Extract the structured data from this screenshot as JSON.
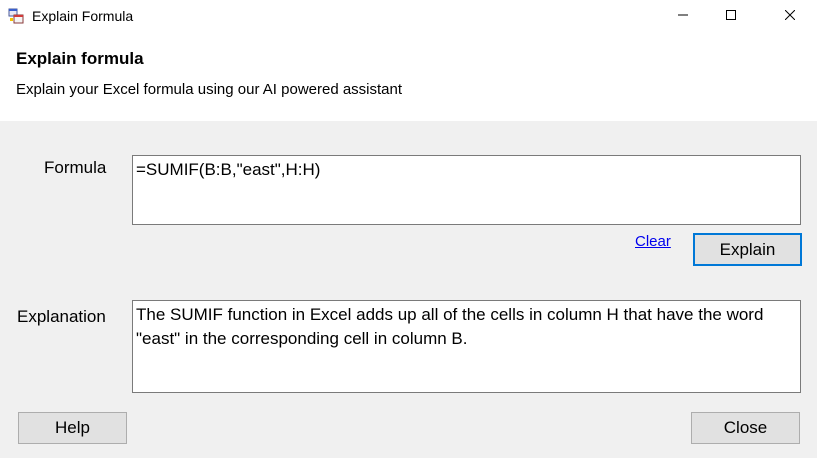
{
  "window": {
    "title": "Explain Formula",
    "icon": "form-app-icon",
    "controls": [
      "minimize-icon",
      "maximize-icon",
      "close-icon"
    ]
  },
  "header": {
    "title": "Explain formula",
    "subtitle": "Explain your Excel formula using our AI powered assistant"
  },
  "formula": {
    "label": "Formula",
    "value": "=SUMIF(B:B,\"east\",H:H)"
  },
  "actions": {
    "clear_label": "Clear",
    "explain_label": "Explain"
  },
  "explanation": {
    "label": "Explanation",
    "value": "The SUMIF function in Excel adds up all of the cells in column H that have the word \"east\" in the corresponding cell in column B."
  },
  "footer": {
    "help_label": "Help",
    "close_label": "Close"
  },
  "colors": {
    "accent": "#0078d7",
    "link": "#0000ee",
    "background": "#f0f0f0"
  }
}
